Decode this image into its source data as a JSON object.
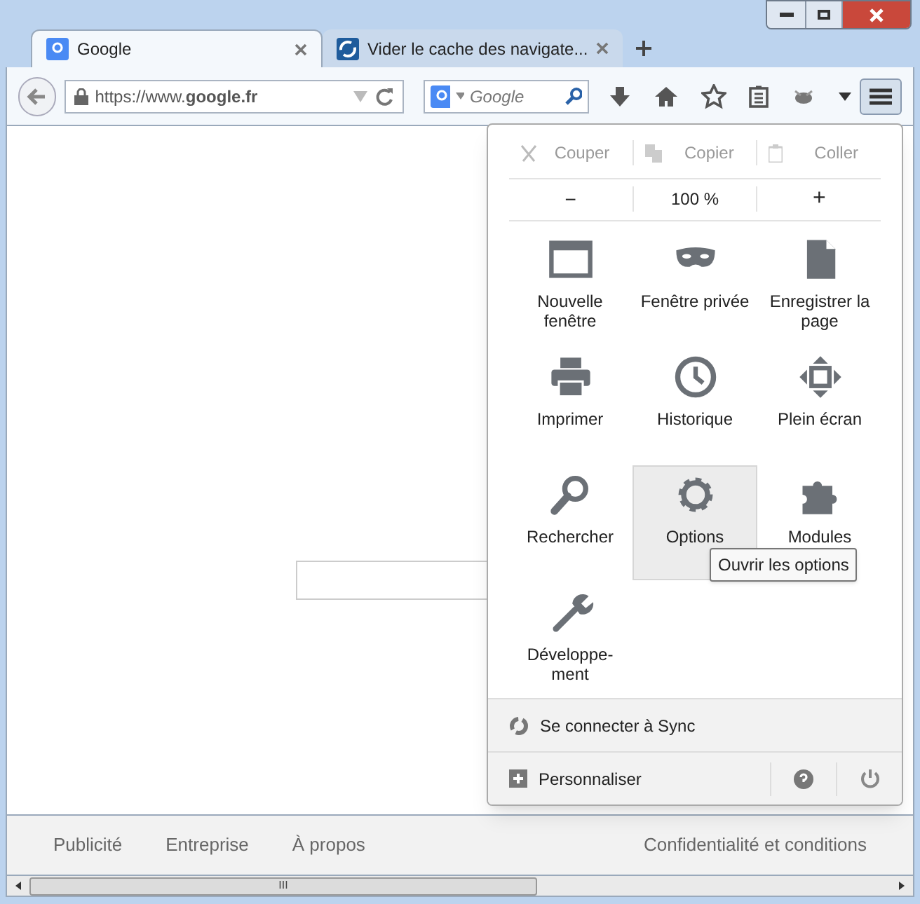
{
  "tabs": [
    {
      "title": "Google",
      "selected": true
    },
    {
      "title": "Vider le cache des navigate...",
      "selected": false
    }
  ],
  "address": {
    "url": "https://www.**google.fr**"
  },
  "search": {
    "placeholder": "Google"
  },
  "menu": {
    "edit": [
      "Couper",
      "Copier",
      "Coller"
    ],
    "zoom": {
      "minus": "−",
      "value": "100 %",
      "plus": "+"
    },
    "items": [
      {
        "label": "Nouvelle fenêtre",
        "selected": false
      },
      {
        "label": "Fenêtre privée",
        "selected": false
      },
      {
        "label": "Enregistrer la page",
        "selected": false
      },
      {
        "label": "Imprimer",
        "selected": false
      },
      {
        "label": "Historique",
        "selected": false
      },
      {
        "label": "Plein écran",
        "selected": false
      },
      {
        "label": "Rechercher",
        "selected": false
      },
      {
        "label": "Options",
        "selected": true
      },
      {
        "label": "Modules",
        "selected": false
      },
      {
        "label": "Développe-\nment",
        "selected": false
      }
    ],
    "tooltip": "Ouvrir les options",
    "sync": "Se connecter à Sync",
    "customize": "Personnaliser"
  },
  "footer": {
    "left": [
      "Publicité",
      "Entreprise",
      "À propos"
    ],
    "right": "Confidentialité et conditions"
  },
  "scrollbar": {
    "grip": "III"
  }
}
